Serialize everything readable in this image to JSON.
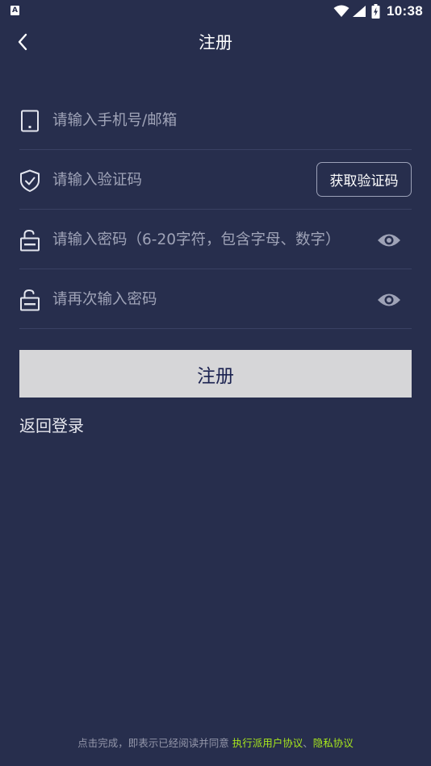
{
  "status_bar": {
    "time": "10:38",
    "left_icon": "app-notification-icon",
    "right_icons": [
      "wifi-icon",
      "cell-signal-icon",
      "battery-charging-icon"
    ]
  },
  "header": {
    "back_icon": "chevron-left-icon",
    "title": "注册"
  },
  "form": {
    "account": {
      "icon": "phone-icon",
      "value": "",
      "placeholder": "请输入手机号/邮箱"
    },
    "code": {
      "icon": "shield-check-icon",
      "value": "",
      "placeholder": "请输入验证码",
      "button_label": "获取验证码"
    },
    "password": {
      "icon": "unlock-icon",
      "value": "",
      "placeholder": "请输入密码（6-20字符，包含字母、数字）",
      "toggle_icon": "eye-icon"
    },
    "password_confirm": {
      "icon": "unlock-icon",
      "value": "",
      "placeholder": "请再次输入密码",
      "toggle_icon": "eye-icon"
    }
  },
  "actions": {
    "register_label": "注册",
    "back_to_login": "返回登录"
  },
  "agreement": {
    "prefix": "点击完成，即表示已经阅读并同意 ",
    "user_agreement": "执行派用户协议",
    "separator": "、",
    "privacy_policy": "隐私协议"
  },
  "colors": {
    "background": "#272e4d",
    "divider": "#3a4163",
    "placeholder": "#9fa3b7",
    "register_button_bg": "#d6d6d8",
    "register_button_text": "#1b2250",
    "link": "#a8e81c"
  }
}
